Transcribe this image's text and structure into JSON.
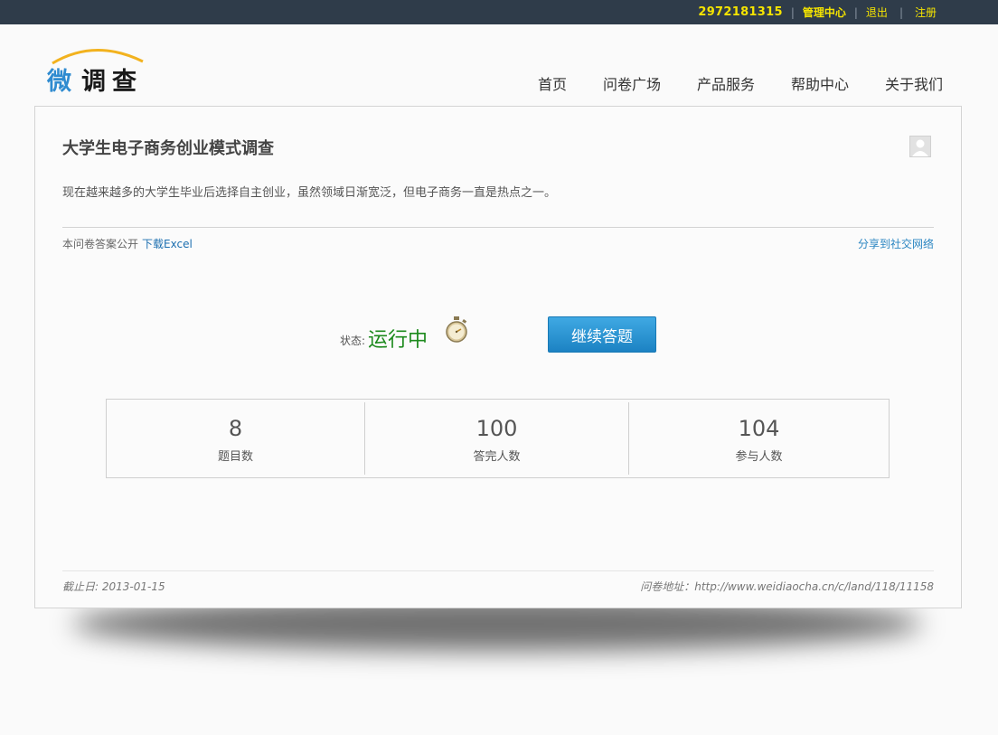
{
  "topbar": {
    "user_id": "2972181315",
    "manage_label": "管理中心",
    "logout_label": "退出",
    "register_label": "注册",
    "separator": "|"
  },
  "logo": {
    "part1": "微",
    "part2": "调查"
  },
  "nav": {
    "items": [
      {
        "label": "首页"
      },
      {
        "label": "问卷广场"
      },
      {
        "label": "产品服务"
      },
      {
        "label": "帮助中心"
      },
      {
        "label": "关于我们"
      }
    ]
  },
  "survey": {
    "title": "大学生电子商务创业模式调查",
    "description": "现在越来越多的大学生毕业后选择自主创业，虽然领域日渐宽泛，但电子商务一直是热点之一。",
    "public_text": "本问卷答案公开",
    "download_label": "下载Excel",
    "share_label": "分享到社交网络",
    "status_label": "状态:",
    "status_value": "运行中",
    "continue_button": "继续答题",
    "stats": [
      {
        "value": "8",
        "label": "题目数"
      },
      {
        "value": "100",
        "label": "答完人数"
      },
      {
        "value": "104",
        "label": "参与人数"
      }
    ],
    "deadline": "截止日: 2013-01-15",
    "address": "问卷地址：http://www.weidiaocha.cn/c/land/118/11158"
  },
  "colors": {
    "topbar_bg": "#2f3c4a",
    "topbar_link": "#f5e400",
    "status_green": "#1d8a1d",
    "button_blue": "#1c82c3",
    "link_blue": "#1c6fb0"
  }
}
